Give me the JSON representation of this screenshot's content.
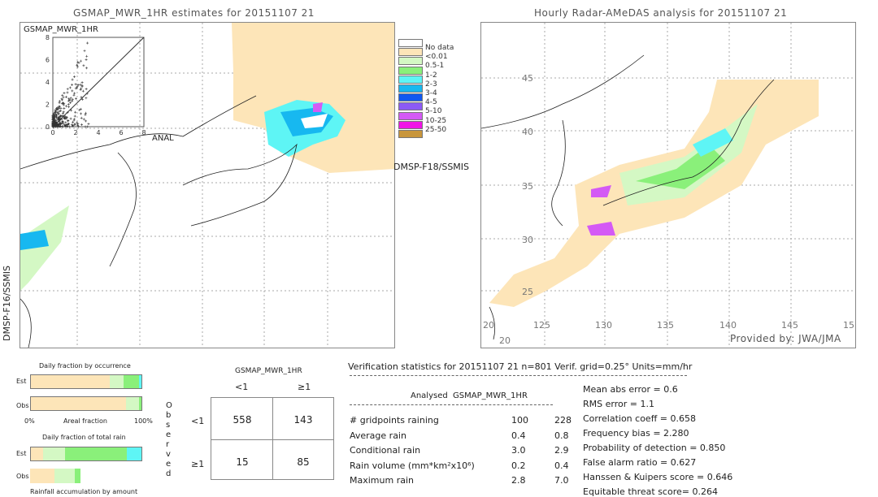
{
  "left_panel": {
    "title": "GSMAP_MWR_1HR estimates for 20151107 21",
    "sensor_right": "DMSP-F18/SSMIS",
    "sensor_left": "DMSP-F16/SSMIS",
    "scatter": {
      "title": "GSMAP_MWR_1HR",
      "xlabel": "ANAL",
      "ticks": [
        "0",
        "2",
        "4",
        "6",
        "8"
      ],
      "xlim": [
        0,
        8
      ],
      "ylim": [
        0,
        8
      ]
    }
  },
  "right_panel": {
    "title": "Hourly Radar-AMeDAS analysis for 20151107 21",
    "credit": "Provided by: JWA/JMA",
    "lat_ticks": [
      "45",
      "40",
      "35",
      "30",
      "25",
      "20"
    ],
    "lon_ticks": [
      "125",
      "130",
      "135",
      "140",
      "145",
      "15"
    ],
    "corner_labels": [
      "20",
      "20"
    ]
  },
  "legend": {
    "items": [
      {
        "label": "No data",
        "color": "#ffffff"
      },
      {
        "label": "<0.01",
        "color": "#fde5b8"
      },
      {
        "label": "0.5-1",
        "color": "#d4f8c4"
      },
      {
        "label": "1-2",
        "color": "#8af07a"
      },
      {
        "label": "2-3",
        "color": "#5ef5f5"
      },
      {
        "label": "3-4",
        "color": "#17b8f0"
      },
      {
        "label": "4-5",
        "color": "#1058f0"
      },
      {
        "label": "5-10",
        "color": "#8c5af5"
      },
      {
        "label": "10-25",
        "color": "#d45af5"
      },
      {
        "label": "25-50",
        "color": "#f014e6"
      },
      {
        "label": "",
        "color": "#c8963c"
      }
    ]
  },
  "fractions": {
    "occurrence_title": "Daily fraction by occurrence",
    "est_label": "Est",
    "obs_label": "Obs",
    "axis_left": "0%",
    "axis_mid": "Areal fraction",
    "axis_right": "100%",
    "total_title": "Daily fraction of total rain",
    "accum_label": "Rainfall accumulation by amount",
    "occ_est": [
      {
        "c": "#fde5b8",
        "v": 71
      },
      {
        "c": "#d4f8c4",
        "v": 13
      },
      {
        "c": "#8af07a",
        "v": 14
      },
      {
        "c": "#5ef5f5",
        "v": 2
      }
    ],
    "occ_obs": [
      {
        "c": "#fde5b8",
        "v": 86
      },
      {
        "c": "#d4f8c4",
        "v": 12
      },
      {
        "c": "#8af07a",
        "v": 2
      }
    ],
    "tot_est": [
      {
        "c": "#fde5b8",
        "v": 11
      },
      {
        "c": "#d4f8c4",
        "v": 20
      },
      {
        "c": "#8af07a",
        "v": 56
      },
      {
        "c": "#5ef5f5",
        "v": 13
      }
    ],
    "tot_obs": [
      {
        "c": "#fde5b8",
        "v": 22
      },
      {
        "c": "#d4f8c4",
        "v": 18
      },
      {
        "c": "#8af07a",
        "v": 5
      }
    ]
  },
  "contingency": {
    "title": "GSMAP_MWR_1HR",
    "col_lt": "<1",
    "col_ge": "≥1",
    "row_lt": "<1",
    "row_ge": "≥1",
    "observed": [
      "O",
      "b",
      "s",
      "e",
      "r",
      "v",
      "e",
      "d"
    ],
    "values": [
      [
        "558",
        "143"
      ],
      [
        "15",
        "85"
      ]
    ]
  },
  "stats": {
    "header": "Verification statistics for 20151107 21   n=801   Verif. grid=0.25°   Units=mm/hr",
    "col_analysed": "Analysed",
    "col_gsmap": "GSMAP_MWR_1HR",
    "rows": [
      {
        "label": "# gridpoints raining",
        "a": "100",
        "g": "228"
      },
      {
        "label": "Average rain",
        "a": "0.4",
        "g": "0.8"
      },
      {
        "label": "Conditional rain",
        "a": "3.0",
        "g": "2.9"
      },
      {
        "label": "Rain volume (mm*km²x10⁶)",
        "a": "0.2",
        "g": "0.4"
      },
      {
        "label": "Maximum rain",
        "a": "2.8",
        "g": "7.0"
      }
    ],
    "scores": [
      "Mean abs error = 0.6",
      "RMS error = 1.1",
      "Correlation coeff = 0.658",
      "Frequency bias = 2.280",
      "Probability of detection = 0.850",
      "False alarm ratio = 0.627",
      "Hanssen & Kuipers score = 0.646",
      "Equitable threat score= 0.264"
    ]
  }
}
